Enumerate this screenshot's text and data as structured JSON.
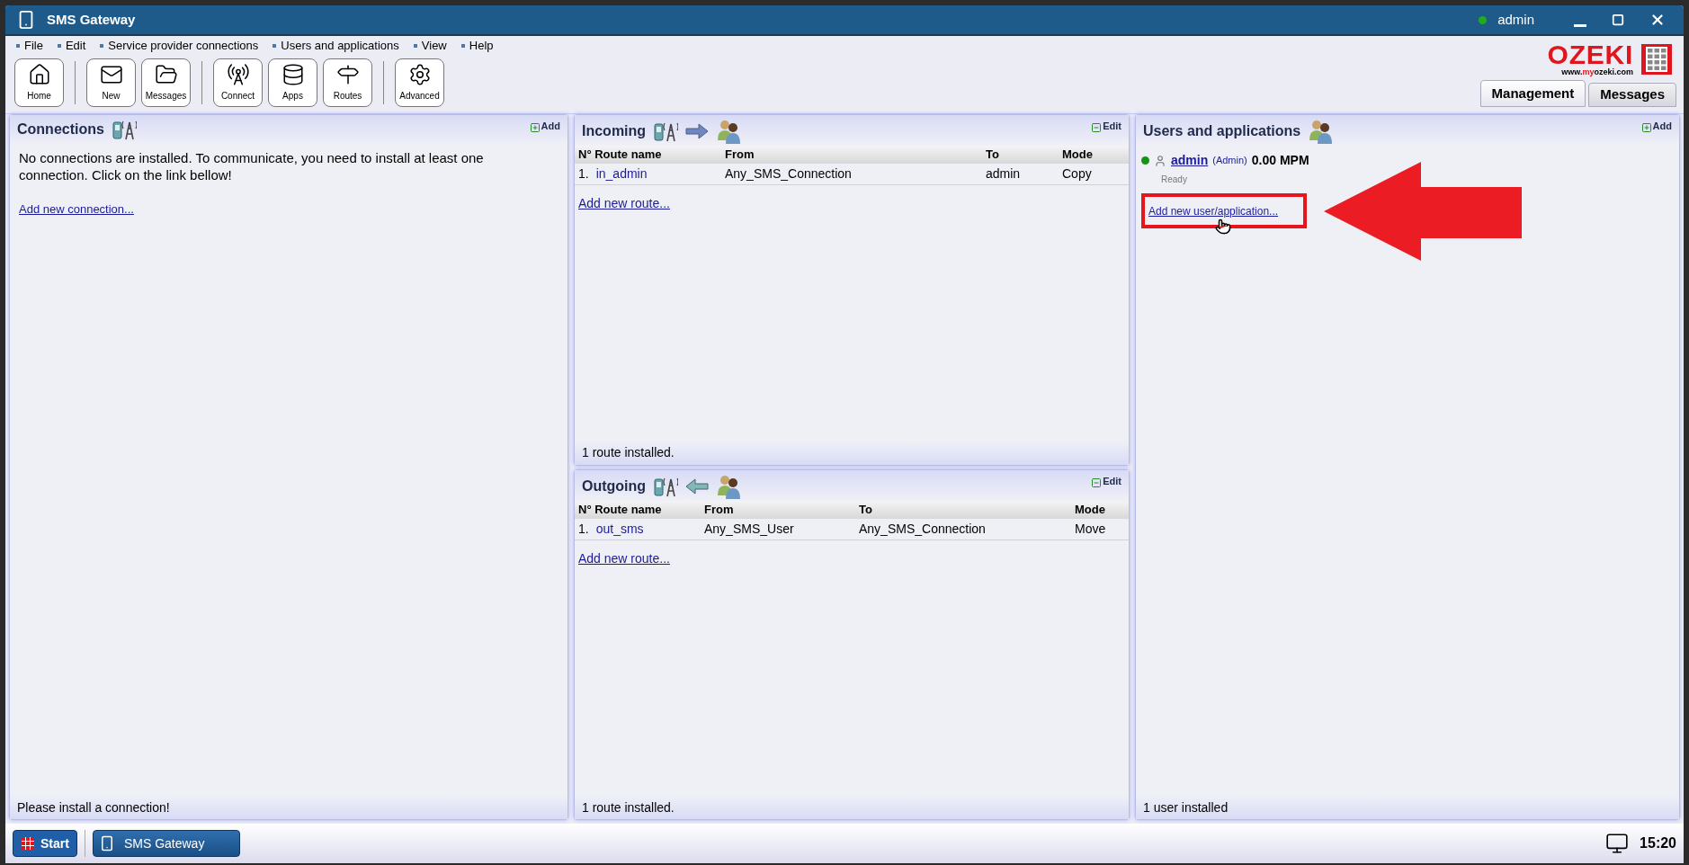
{
  "window": {
    "title": "SMS Gateway",
    "user": "admin",
    "user_online": true
  },
  "menu": [
    "File",
    "Edit",
    "Service provider connections",
    "Users and applications",
    "View",
    "Help"
  ],
  "toolbar": [
    [
      {
        "kind": "home",
        "label": "Home"
      }
    ],
    [
      {
        "kind": "new",
        "label": "New"
      },
      {
        "kind": "messages",
        "label": "Messages"
      }
    ],
    [
      {
        "kind": "connect",
        "label": "Connect"
      },
      {
        "kind": "apps",
        "label": "Apps"
      },
      {
        "kind": "routes",
        "label": "Routes"
      }
    ],
    [
      {
        "kind": "advanced",
        "label": "Advanced"
      }
    ]
  ],
  "logo": {
    "name": "OZEKI",
    "url_start": "www.",
    "url_highlight": "my",
    "url_end": "ozeki.com"
  },
  "tabs": [
    {
      "label": "Management",
      "selected": true
    },
    {
      "label": "Messages",
      "selected": false
    }
  ],
  "connections": {
    "title": "Connections",
    "action": "Add",
    "message": "No connections are installed. To communicate, you need to install at least one connection. Click on the link bellow!",
    "link": "Add new connection...",
    "footer": "Please install a connection!"
  },
  "incoming": {
    "title": "Incoming",
    "action": "Edit",
    "columns": [
      "N° Route name",
      "From",
      "To",
      "Mode"
    ],
    "rows": [
      {
        "number": "1.",
        "name": "in_admin",
        "from": "Any_SMS_Connection",
        "to": "admin",
        "mode": "Copy"
      }
    ],
    "link": "Add new route...",
    "footer": "1 route installed."
  },
  "outgoing": {
    "title": "Outgoing",
    "action": "Edit",
    "columns": [
      "N° Route name",
      "From",
      "To",
      "Mode"
    ],
    "rows": [
      {
        "number": "1.",
        "name": "out_sms",
        "from": "Any_SMS_User",
        "to": "Any_SMS_Connection",
        "mode": "Move"
      }
    ],
    "link": "Add new route...",
    "footer": "1 route installed."
  },
  "users": {
    "title": "Users and applications",
    "action": "Add",
    "items": [
      {
        "name": "admin",
        "role": "(Admin)",
        "rate": "0.00 MPM",
        "status": "Ready",
        "color": "#149414"
      }
    ],
    "link": "Add new user/application...",
    "footer": "1 user installed"
  },
  "taskbar": {
    "start": "Start",
    "task": "SMS Gateway",
    "clock": "15:20"
  }
}
